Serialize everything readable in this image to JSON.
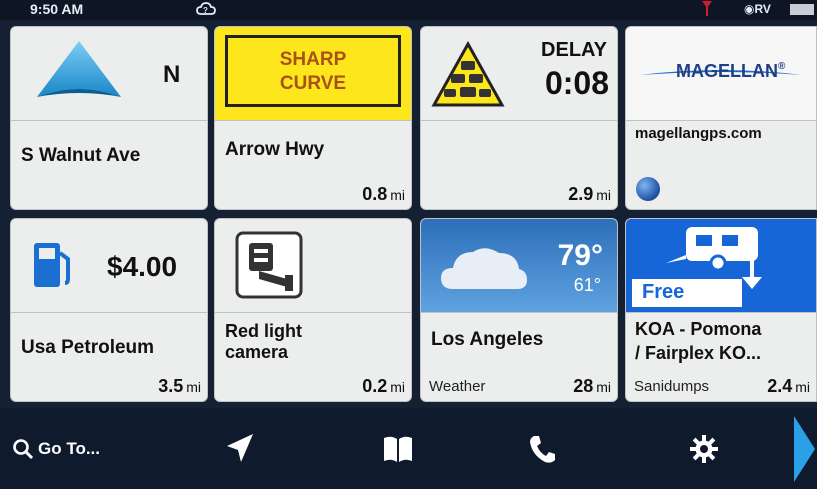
{
  "status": {
    "time": "9:50 AM",
    "gps": "RV"
  },
  "tiles": {
    "heading": {
      "direction": "N",
      "street": "S Walnut Ave"
    },
    "curve": {
      "sign_line1": "SHARP",
      "sign_line2": "CURVE",
      "road": "Arrow Hwy",
      "distance": "0.8",
      "unit": "mi"
    },
    "delay": {
      "label": "DELAY",
      "time": "0:08",
      "distance": "2.9",
      "unit": "mi"
    },
    "ad": {
      "logo": "MAGELLAN",
      "logo_mark": "®",
      "url": "magellangps.com"
    },
    "fuel": {
      "price": "$4.00",
      "name": "Usa Petroleum",
      "distance": "3.5",
      "unit": "mi"
    },
    "camera": {
      "title_line1": "Red light",
      "title_line2": "camera",
      "distance": "0.2",
      "unit": "mi"
    },
    "weather": {
      "temp_high": "79°",
      "temp_low": "61°",
      "city": "Los Angeles",
      "label": "Weather",
      "distance": "28",
      "unit": "mi"
    },
    "koa": {
      "badge": "Free",
      "title_line1": "KOA - Pomona",
      "title_line2": "/ Fairplex KO...",
      "category": "Sanidumps",
      "distance": "2.4",
      "unit": "mi"
    }
  },
  "navbar": {
    "goto_label": "Go To..."
  },
  "colors": {
    "yellow": "#fde61c",
    "sky": "#3b82c9",
    "koa_blue": "#1666d8",
    "nav_bg": "#0f1a2d"
  }
}
